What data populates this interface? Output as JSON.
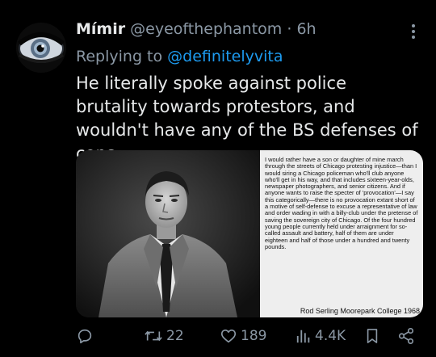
{
  "tweet": {
    "display_name": "Mímir",
    "handle": "@eyeofthephantom",
    "separator": "·",
    "time": "6h",
    "replying_prefix": "Replying to",
    "replying_to": "@definitelyvita",
    "text": "He literally spoke against police brutality towards protestors, and wouldn't have any of the BS defenses of cops.",
    "avatar_icon": "eye-avatar",
    "more_icon": "vertical-ellipsis-icon"
  },
  "media": {
    "quote_text": "I would rather have a son or daughter of mine march through the streets of Chicago protesting injustice—than I would siring a Chicago policeman who'll club anyone who'll get in his way, and that includes sixteen-year-olds, newspaper photographers, and senior citizens. And if anyone wants to raise the specter of 'provocation'—I say this categorically—there is no provocation extant short of a motive of self-defense to excuse a representative of law and order wading in with a billy-club under the pretense of saving the sovereign city of Chicago. Of the four hundred young people currently held under arraignment for so-called assault and battery, half of them are under eighteen and half of those under a hundred and twenty pounds.",
    "attribution": "Rod Serling Moorepark College 1968",
    "photo_description_icon": "black-and-white-portrait"
  },
  "actions": {
    "reply_icon": "reply-icon",
    "retweet_icon": "retweet-icon",
    "retweets": "22",
    "like_icon": "heart-icon",
    "likes": "189",
    "views_icon": "views-chart-icon",
    "views": "4.4K",
    "bookmark_icon": "bookmark-icon",
    "share_icon": "share-icon"
  },
  "colors": {
    "background": "#000000",
    "text": "#e7e9ea",
    "muted": "#8b98a5",
    "accent": "#1d9bf0"
  }
}
